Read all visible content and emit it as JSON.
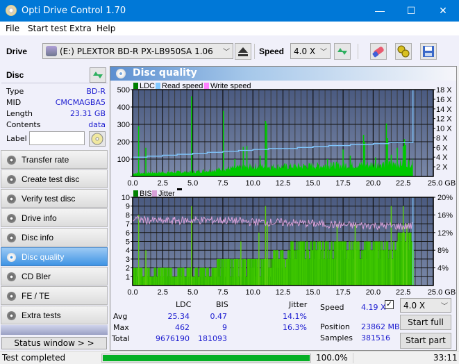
{
  "window": {
    "title": "Opti Drive Control 1.70",
    "minimize": "—",
    "maximize": "☐",
    "close": "✕"
  },
  "menu": [
    "File",
    "Start test",
    "Extra",
    "Help"
  ],
  "toolbar": {
    "drive_label": "Drive",
    "drive_value": "(E:)  PLEXTOR BD-R  PX-LB950SA 1.06",
    "speed_label": "Speed",
    "speed_value": "4.0 X",
    "icons": [
      "drive-icon",
      "eject-icon",
      "refresh-speed-icon",
      "erase-icon",
      "settings-icon",
      "save-icon"
    ]
  },
  "disc": {
    "header": "Disc",
    "rows": [
      {
        "key": "Type",
        "value": "BD-R"
      },
      {
        "key": "MID",
        "value": "CMCMAGBA5"
      },
      {
        "key": "Length",
        "value": "23.31 GB"
      },
      {
        "key": "Contents",
        "value": "data"
      }
    ],
    "label_key": "Label",
    "label_value": ""
  },
  "nav": [
    {
      "label": "Transfer rate",
      "active": false
    },
    {
      "label": "Create test disc",
      "active": false
    },
    {
      "label": "Verify test disc",
      "active": false
    },
    {
      "label": "Drive info",
      "active": false
    },
    {
      "label": "Disc info",
      "active": false
    },
    {
      "label": "Disc quality",
      "active": true
    },
    {
      "label": "CD Bler",
      "active": false
    },
    {
      "label": "FE / TE",
      "active": false
    },
    {
      "label": "Extra tests",
      "active": false
    }
  ],
  "status_window_label": "Status window > >",
  "panel_title": "Disc quality",
  "colors": {
    "ldc": "#008000",
    "ldc_fill": "#00c800",
    "bis_fill": "#40c800",
    "read_speed": "#80c8ff",
    "write_speed": "#ff80ff",
    "jitter": "#d8a0d8",
    "plot_bg_top": "#4a5a80",
    "plot_bg_bottom": "#7a88a8",
    "accent": "#0078d7",
    "progress": "#06b025"
  },
  "chart_data": [
    {
      "type": "bar",
      "title": "LDC / Read speed / Write speed",
      "legend": [
        "LDC",
        "Read speed",
        "Write speed"
      ],
      "legend_position": "top-left",
      "xlabel": "GB",
      "x_ticks": [
        "0.0",
        "2.5",
        "5.0",
        "7.5",
        "10.0",
        "12.5",
        "15.0",
        "17.5",
        "20.0",
        "22.5",
        "25.0 GB"
      ],
      "xlim": [
        0,
        25
      ],
      "y_left_ticks": [
        "100",
        "200",
        "300",
        "400",
        "500"
      ],
      "ylim_left": [
        0,
        500
      ],
      "y_right_ticks": [
        "2 X",
        "4 X",
        "6 X",
        "8 X",
        "10 X",
        "12 X",
        "14 X",
        "16 X",
        "18 X"
      ],
      "ylim_right": [
        0,
        18
      ],
      "grid": true,
      "ldc_baseline": [
        [
          0,
          20
        ],
        [
          2.5,
          25
        ],
        [
          5,
          28
        ],
        [
          7.5,
          45
        ],
        [
          10,
          62
        ],
        [
          12.5,
          60
        ],
        [
          15,
          65
        ],
        [
          17.5,
          68
        ],
        [
          20,
          72
        ],
        [
          22.5,
          80
        ],
        [
          23.3,
          85
        ]
      ],
      "ldc_spikes": [
        [
          0.5,
          290
        ],
        [
          1.1,
          165
        ],
        [
          4.9,
          462
        ],
        [
          7.55,
          378
        ],
        [
          8.5,
          100
        ],
        [
          9.2,
          170
        ],
        [
          9.5,
          175
        ],
        [
          10.6,
          120
        ],
        [
          11.05,
          320
        ],
        [
          11.15,
          305
        ],
        [
          12.8,
          60
        ],
        [
          14.2,
          60
        ],
        [
          16.2,
          100
        ],
        [
          16.5,
          80
        ],
        [
          17.5,
          155
        ],
        [
          18.1,
          120
        ],
        [
          19.2,
          240
        ],
        [
          19.3,
          200
        ],
        [
          20.2,
          110
        ],
        [
          21.1,
          305
        ],
        [
          21.2,
          220
        ],
        [
          21.5,
          125
        ],
        [
          22.0,
          165
        ],
        [
          22.5,
          175
        ],
        [
          22.6,
          215
        ],
        [
          22.7,
          180
        ]
      ],
      "read_speed": [
        [
          0,
          4.0
        ],
        [
          1.2,
          4.2
        ],
        [
          2.5,
          4.4
        ],
        [
          3.7,
          4.6
        ],
        [
          5.0,
          4.8
        ],
        [
          6.2,
          5.0
        ],
        [
          7.5,
          5.2
        ],
        [
          8.8,
          5.4
        ],
        [
          10.0,
          5.6
        ],
        [
          11.3,
          5.8
        ],
        [
          13.7,
          6.0
        ],
        [
          15.0,
          6.2
        ],
        [
          16.3,
          6.4
        ],
        [
          18.1,
          6.6
        ],
        [
          20.0,
          6.8
        ],
        [
          21.3,
          7.0
        ],
        [
          23.0,
          7.0
        ],
        [
          23.31,
          7.3
        ],
        [
          23.31,
          18
        ]
      ],
      "write_speed": []
    },
    {
      "type": "bar",
      "title": "BIS / Jitter",
      "legend": [
        "BIS",
        "Jitter"
      ],
      "legend_position": "top-left",
      "xlabel": "GB",
      "x_ticks": [
        "0.0",
        "2.5",
        "5.0",
        "7.5",
        "10.0",
        "12.5",
        "15.0",
        "17.5",
        "20.0",
        "22.5",
        "25.0 GB"
      ],
      "xlim": [
        0,
        25
      ],
      "y_left_ticks": [
        "1",
        "2",
        "3",
        "4",
        "5",
        "6",
        "7",
        "8",
        "9",
        "10"
      ],
      "ylim_left": [
        0,
        10
      ],
      "y_right_ticks": [
        "4%",
        "8%",
        "12%",
        "16%",
        "20%"
      ],
      "ylim_right": [
        0,
        20
      ],
      "grid": true,
      "bis_levels": [
        [
          0,
          2
        ],
        [
          2.0,
          2
        ],
        [
          7.0,
          3
        ],
        [
          11.5,
          4
        ],
        [
          13.0,
          5
        ],
        [
          22.0,
          6
        ],
        [
          23.31,
          6
        ]
      ],
      "bis_spikes": [
        [
          0.5,
          8
        ],
        [
          1.1,
          4
        ],
        [
          4.9,
          9
        ],
        [
          9.0,
          5
        ],
        [
          10.5,
          6
        ],
        [
          11.05,
          9
        ],
        [
          11.2,
          7
        ],
        [
          17.0,
          7
        ],
        [
          18.5,
          7
        ],
        [
          21.5,
          9
        ],
        [
          22.5,
          9
        ],
        [
          22.8,
          7
        ]
      ],
      "jitter_percent": [
        [
          0,
          15.0
        ],
        [
          2.5,
          14.6
        ],
        [
          5.0,
          14.8
        ],
        [
          7.5,
          14.8
        ],
        [
          10.0,
          14.4
        ],
        [
          12.5,
          14.3
        ],
        [
          15.0,
          14.0
        ],
        [
          17.5,
          13.7
        ],
        [
          20.0,
          13.6
        ],
        [
          22.5,
          13.4
        ],
        [
          23.31,
          13.5
        ]
      ]
    }
  ],
  "stats": {
    "col_ldc": "LDC",
    "col_bis": "BIS",
    "jitter_label": "Jitter",
    "jitter_checked": true,
    "rows": [
      {
        "label": "Avg",
        "ldc": "25.34",
        "bis": "0.47",
        "jitter": "14.1%"
      },
      {
        "label": "Max",
        "ldc": "462",
        "bis": "9",
        "jitter": "16.3%"
      },
      {
        "label": "Total",
        "ldc": "9676190",
        "bis": "181093",
        "jitter": ""
      }
    ],
    "speed_label": "Speed",
    "speed_value": "4.19 X",
    "position_label": "Position",
    "position_value": "23862 MB",
    "samples_label": "Samples",
    "samples_value": "381516",
    "speed_select": "4.0 X",
    "start_full": "Start full",
    "start_part": "Start part"
  },
  "statusbar": {
    "text": "Test completed",
    "progress_percent": 100.0,
    "progress_label": "100.0%",
    "time": "33:11"
  }
}
